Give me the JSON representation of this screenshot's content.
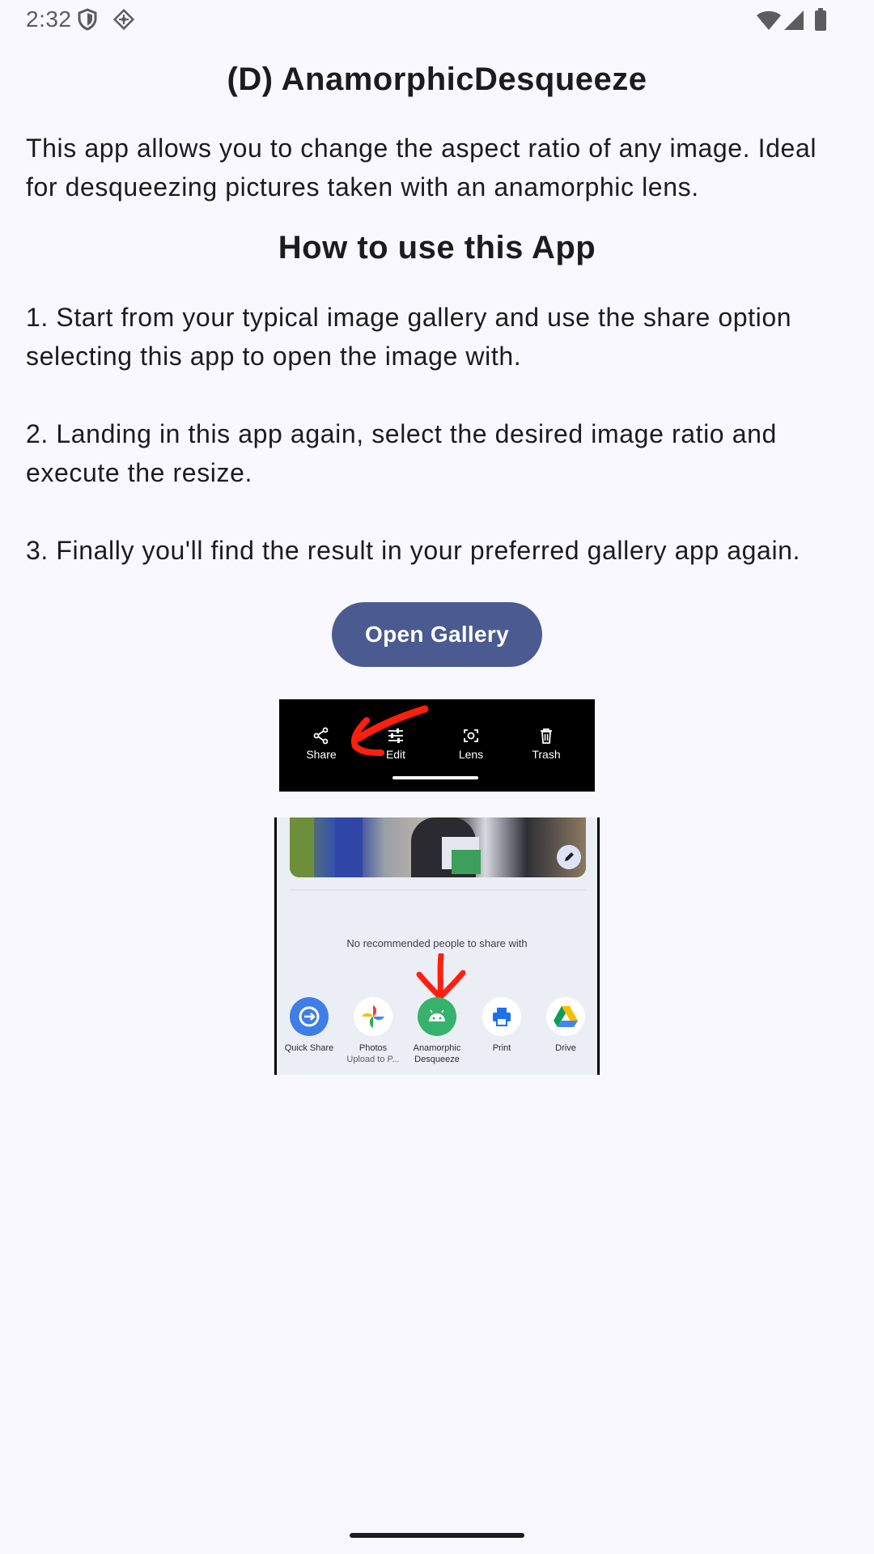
{
  "status_bar": {
    "time": "2:32",
    "left_icons": [
      "shield-icon",
      "app-notification-icon"
    ],
    "right_icons": [
      "wifi-icon",
      "signal-icon",
      "battery-icon"
    ]
  },
  "header": {
    "title": "(D) AnamorphicDesqueeze"
  },
  "intro": {
    "line1": "This app allows you to change the aspect ratio of any image. Ideal",
    "line2": "for desqueezing pictures taken with an anamorphic lens."
  },
  "howto": {
    "title": "How to use this App",
    "step1_line1": "1. Start from your typical image gallery and use the share option",
    "step1_line2": "selecting this app to open the image with.",
    "step2_line1": "2. Landing in this app again, select the desired image ratio and",
    "step2_line2": "execute the resize.",
    "step3": "3. Finally you'll find the result in your preferred gallery app again."
  },
  "actions": {
    "open_gallery": "Open Gallery"
  },
  "illustration_toolbar": {
    "items": [
      {
        "label": "Share",
        "icon": "share-icon"
      },
      {
        "label": "Edit",
        "icon": "sliders-icon"
      },
      {
        "label": "Lens",
        "icon": "lens-icon"
      },
      {
        "label": "Trash",
        "icon": "trash-icon"
      }
    ]
  },
  "illustration_share_sheet": {
    "no_people": "No recommended people to share with",
    "apps": [
      {
        "label": "Quick Share",
        "sub": ""
      },
      {
        "label": "Photos",
        "sub": "Upload to P..."
      },
      {
        "label": "Anamorphic",
        "sub": "Desqueeze"
      },
      {
        "label": "Print",
        "sub": ""
      },
      {
        "label": "Drive",
        "sub": ""
      }
    ]
  },
  "colors": {
    "background": "#f8f8fe",
    "button": "#4b5b91",
    "annotation": "#ff1f0f"
  }
}
